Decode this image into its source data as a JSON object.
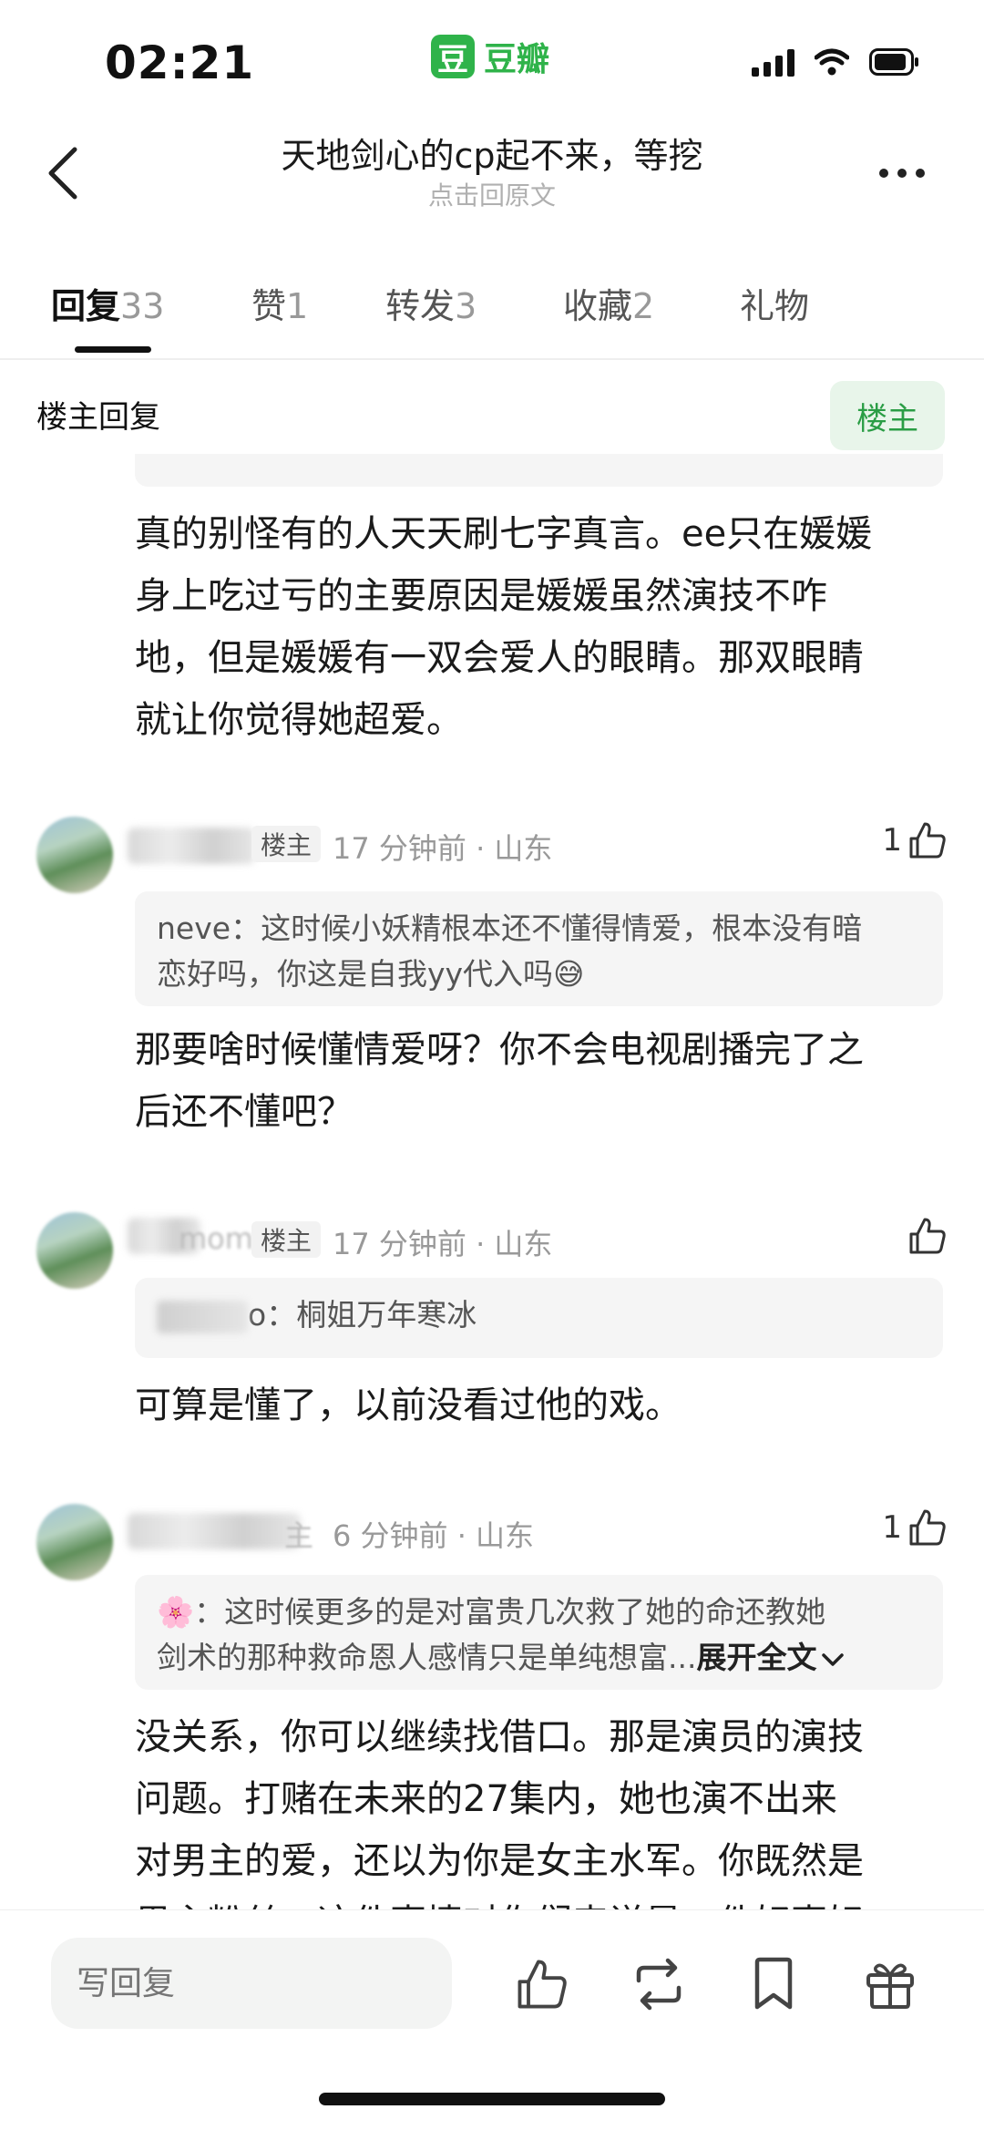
{
  "status_bar": {
    "time": "02:21",
    "app_logo_char": "豆",
    "app_name": "豆瓣"
  },
  "nav": {
    "title": "天地剑心的cp起不来，等挖",
    "subtitle": "点击回原文"
  },
  "tabs": [
    {
      "label": "回复",
      "count": "33"
    },
    {
      "label": "赞",
      "count": "1"
    },
    {
      "label": "转发",
      "count": "3"
    },
    {
      "label": "收藏",
      "count": "2"
    },
    {
      "label": "礼物",
      "count": ""
    }
  ],
  "filter": {
    "label": "楼主回复",
    "owner_button": "楼主"
  },
  "top_post": {
    "lines": [
      "真的别怪有的人天天刷七字真言。ee只在媛媛",
      "身上吃过亏的主要原因是媛媛虽然演技不咋",
      "地，但是媛媛有一双会爱人的眼睛。那双眼睛",
      "就让你觉得她超爱。"
    ]
  },
  "comments": [
    {
      "owner_tag": "楼主",
      "meta": "17 分钟前 · 山东",
      "likes": "1",
      "quote_name": "neve",
      "quote_text_1": "：这时候小妖精根本还不懂得情爱，根本没有暗",
      "quote_text_2": "恋好吗，你这是自我yy代入吗😅",
      "lines": [
        "那要啥时候懂情爱呀？你不会电视剧播完了之",
        "后还不懂吧？"
      ]
    },
    {
      "name_partial": "momo",
      "owner_tag": "楼主",
      "meta": "17 分钟前 · 山东",
      "likes": "",
      "quote_name_tail": "o",
      "quote_text_1": "：桐姐万年寒冰",
      "lines": [
        "可算是懂了，以前没看过他的戏。"
      ]
    },
    {
      "name_tail": "主",
      "meta": "6 分钟前 · 山东",
      "likes": "1",
      "quote_name": "🌸",
      "quote_text_1": "：这时候更多的是对富贵几次救了她的命还教她",
      "quote_text_2": "剑术的那种救命恩人感情只是单纯想富...",
      "expand_label": "展开全文",
      "lines": [
        "没关系，你可以继续找借口。那是演员的演技",
        "问题。打赌在未来的27集内，她也演不出来",
        "对男主的爱，还以为你是女主水军。你既然是",
        "男主粉丝，这件事情对你们来说是一件好事好"
      ]
    }
  ],
  "bottom_bar": {
    "reply_placeholder": "写回复"
  },
  "colors": {
    "accent_green": "#2fb34a",
    "owner_btn_bg": "#e8f5ea",
    "quote_bg": "#f5f5f5"
  }
}
